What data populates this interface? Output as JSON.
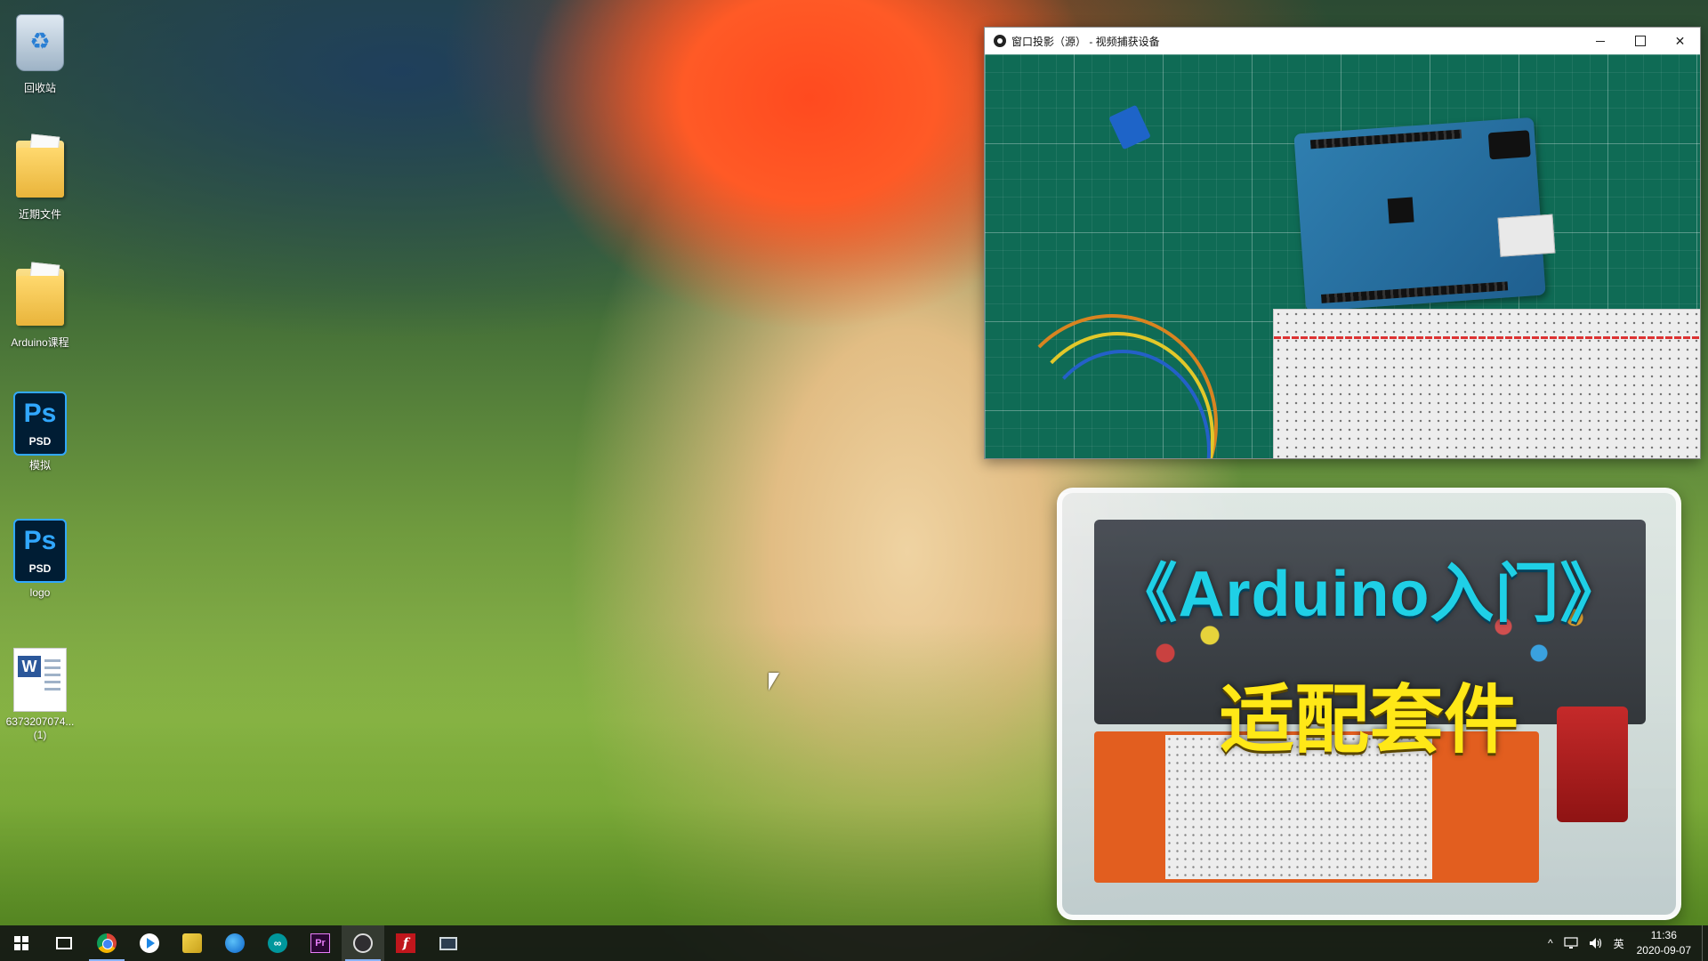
{
  "desktop": {
    "icons": [
      {
        "label": "回收站",
        "icon": "recycle-bin-icon"
      },
      {
        "label": "近期文件",
        "icon": "folder-icon"
      },
      {
        "label": "Arduino课程",
        "icon": "folder-icon"
      },
      {
        "label": "模拟",
        "icon": "psd-file-icon",
        "badge_main": "Ps",
        "badge_sub": "PSD"
      },
      {
        "label": "logo",
        "icon": "psd-file-icon",
        "badge_main": "Ps",
        "badge_sub": "PSD"
      },
      {
        "label": "6373207074...",
        "label_line2": "(1)",
        "icon": "word-document-icon",
        "badge_main": "W"
      }
    ]
  },
  "capture_window": {
    "title": "窗口投影（源） - 视频捕获设备",
    "controls": {
      "minimize": "minimize-icon",
      "maximize": "maximize-icon",
      "close": "✕"
    }
  },
  "promo": {
    "title": "《Arduino入门》",
    "subtitle": "适配套件"
  },
  "taskbar": {
    "apps": [
      {
        "name": "start",
        "icon": "windows-start-icon"
      },
      {
        "name": "task-view",
        "icon": "task-view-icon"
      },
      {
        "name": "chrome",
        "icon": "chrome-icon",
        "active": true
      },
      {
        "name": "media-player",
        "icon": "media-player-icon"
      },
      {
        "name": "sticky-notes",
        "icon": "sticky-notes-icon"
      },
      {
        "name": "edge",
        "icon": "edge-icon"
      },
      {
        "name": "arduino-ide",
        "icon": "arduino-icon",
        "glyph": "∞"
      },
      {
        "name": "premiere",
        "icon": "premiere-icon",
        "glyph": "Pr"
      },
      {
        "name": "obs",
        "icon": "obs-icon",
        "running": true
      },
      {
        "name": "flash",
        "icon": "flash-icon",
        "glyph": "f"
      },
      {
        "name": "remote-desktop",
        "icon": "monitor-icon"
      }
    ],
    "tray": {
      "chevron": "^",
      "network": "network-icon",
      "volume": "volume-icon",
      "language": "英",
      "time": "11:36",
      "date": "2020-09-07"
    }
  },
  "colors": {
    "promo_title": "#1fd0e6",
    "promo_subtitle": "#ffe817",
    "taskbar_bg": "#121614"
  }
}
